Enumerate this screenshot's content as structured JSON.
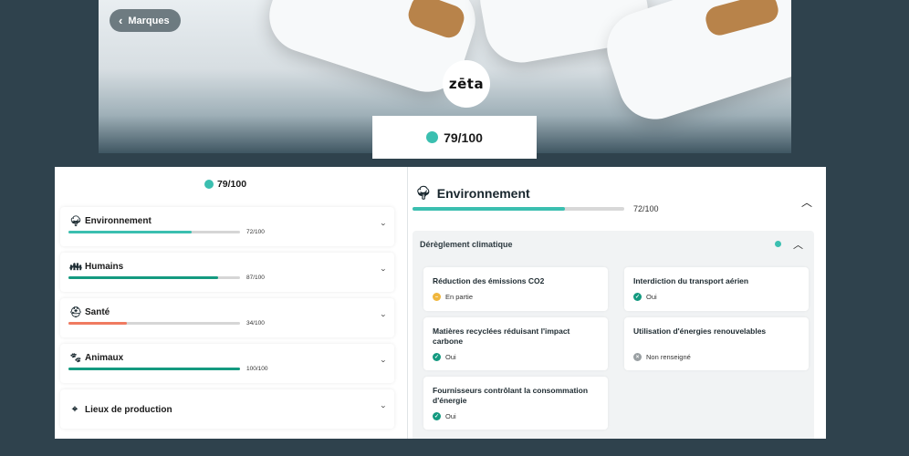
{
  "header": {
    "back_label": "Marques",
    "brand_logo_text": "zēta",
    "score": "79/100"
  },
  "left": {
    "score": "79/100",
    "categories": [
      {
        "label": "Environnement",
        "value": "72/100",
        "progress": 0.72,
        "color": "#3bbfb0",
        "icon": "tree-icon"
      },
      {
        "label": "Humains",
        "value": "87/100",
        "progress": 0.87,
        "color": "#149a80",
        "icon": "people-icon"
      },
      {
        "label": "Santé",
        "value": "34/100",
        "progress": 0.34,
        "color": "#f07a60",
        "icon": "medical-kit-icon"
      },
      {
        "label": "Animaux",
        "value": "100/100",
        "progress": 1.0,
        "color": "#149a80",
        "icon": "paw-icon"
      },
      {
        "label": "Lieux de production",
        "value": "",
        "progress": null,
        "color": "",
        "icon": "location-pin-icon"
      }
    ]
  },
  "right": {
    "title": "Environnement",
    "value": "72/100",
    "progress": 0.72,
    "subsection": {
      "title": "Dérèglement climatique",
      "criteria": [
        {
          "name": "Réduction des émissions CO2",
          "status": "En partie",
          "status_type": "partial",
          "status_color": "#f0b63c"
        },
        {
          "name": "Interdiction du transport aérien",
          "status": "Oui",
          "status_type": "yes",
          "status_color": "#149a80"
        },
        {
          "name": "Matières recyclées réduisant l'impact carbone",
          "status": "Oui",
          "status_type": "yes",
          "status_color": "#149a80"
        },
        {
          "name": "Utilisation d'énergies renouvelables",
          "status": "Non renseigné",
          "status_type": "unknown",
          "status_color": "#9aa0a3"
        },
        {
          "name": "Fournisseurs contrôlant la consommation d'énergie",
          "status": "Oui",
          "status_type": "yes",
          "status_color": "#149a80"
        }
      ]
    }
  },
  "colors": {
    "accent": "#3bbfb0",
    "background": "#2f424d"
  }
}
